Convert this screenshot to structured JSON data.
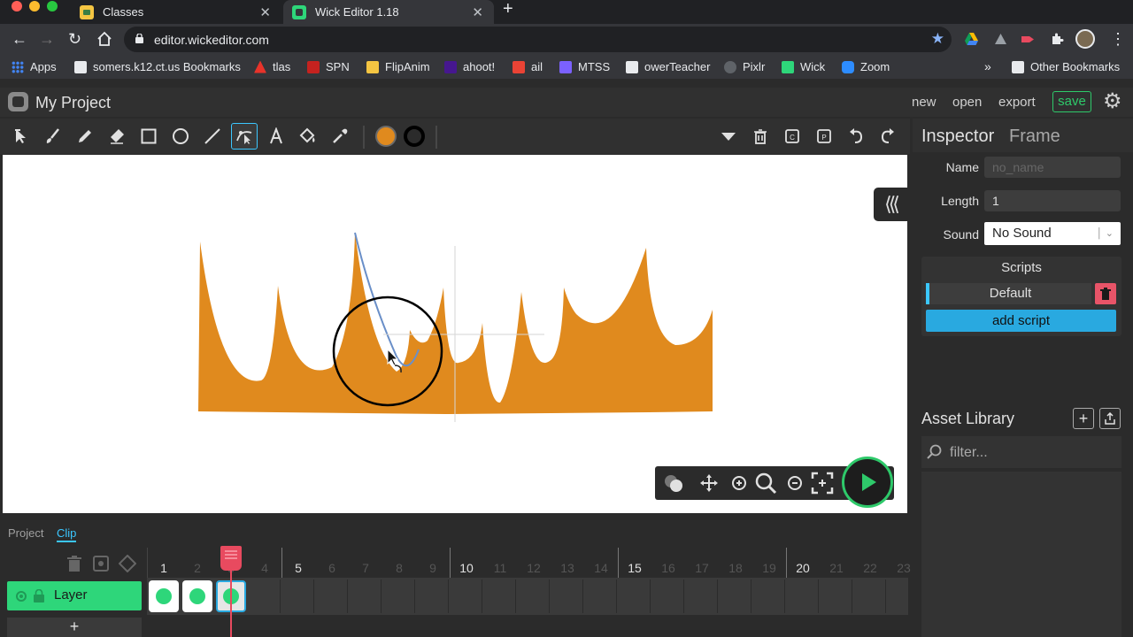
{
  "browser": {
    "tabs": [
      {
        "title": "Classes",
        "active": false
      },
      {
        "title": "Wick Editor 1.18",
        "active": true
      }
    ],
    "url": "editor.wickeditor.com",
    "bookmarks": [
      {
        "label": "Apps"
      },
      {
        "label": "somers.k12.ct.us Bookmarks"
      },
      {
        "label": "tlas"
      },
      {
        "label": "SPN"
      },
      {
        "label": "FlipAnim"
      },
      {
        "label": "ahoot!"
      },
      {
        "label": "ail"
      },
      {
        "label": "MTSS"
      },
      {
        "label": "owerTeacher"
      },
      {
        "label": "Pixlr"
      },
      {
        "label": "Wick"
      },
      {
        "label": "Zoom"
      }
    ],
    "more": "»",
    "other_bookmarks": "Other Bookmarks"
  },
  "editor": {
    "project_title": "My Project",
    "menu": {
      "new": "new",
      "open": "open",
      "export": "export",
      "save": "save"
    },
    "fill_color": "#e08a1e",
    "stroke_color": "#000000"
  },
  "inspector": {
    "title": "Inspector",
    "kind": "Frame",
    "name_label": "Name",
    "name_placeholder": "no_name",
    "length_label": "Length",
    "length_value": "1",
    "sound_label": "Sound",
    "sound_value": "No Sound",
    "scripts_title": "Scripts",
    "script_default": "Default",
    "add_script": "add script"
  },
  "assets": {
    "title": "Asset Library",
    "filter_placeholder": "filter..."
  },
  "timeline": {
    "tabs": {
      "project": "Project",
      "clip": "Clip"
    },
    "frame_numbers": [
      "1",
      "2",
      "3",
      "4",
      "5",
      "6",
      "7",
      "8",
      "9",
      "10",
      "11",
      "12",
      "13",
      "14",
      "15",
      "16",
      "17",
      "18",
      "19",
      "20",
      "21",
      "22",
      "23"
    ],
    "layer_name": "Layer",
    "add_layer": "+",
    "playhead_frame": 3
  }
}
